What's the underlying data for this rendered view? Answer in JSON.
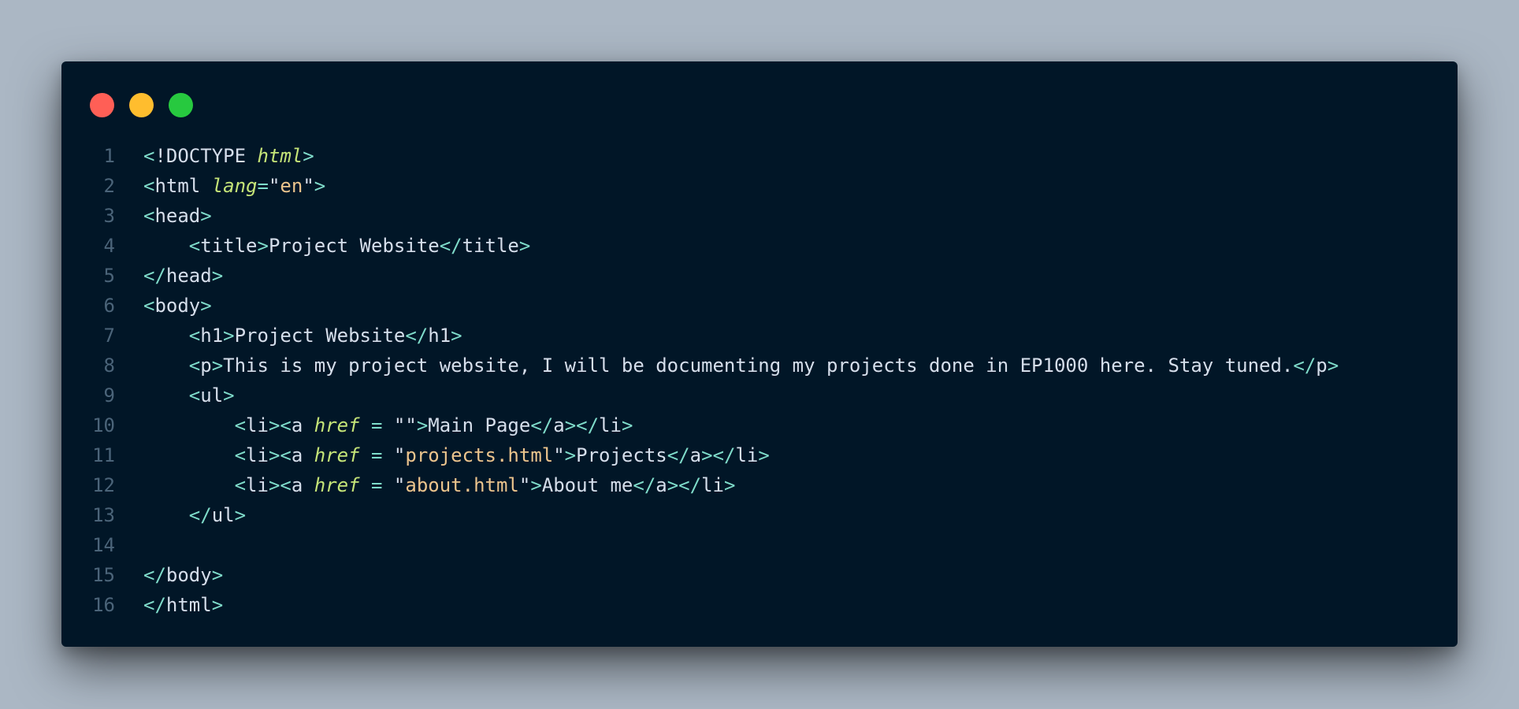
{
  "window": {
    "controls": [
      {
        "name": "close",
        "color": "#ff5f56"
      },
      {
        "name": "minimize",
        "color": "#ffbd2e"
      },
      {
        "name": "maximize",
        "color": "#27c93f"
      }
    ]
  },
  "editor": {
    "lines": [
      {
        "num": "1",
        "tokens": [
          {
            "t": "<",
            "c": "punc"
          },
          {
            "t": "!DOCTYPE ",
            "c": "kw"
          },
          {
            "t": "html",
            "c": "attr"
          },
          {
            "t": ">",
            "c": "punc"
          }
        ]
      },
      {
        "num": "2",
        "tokens": [
          {
            "t": "<",
            "c": "punc"
          },
          {
            "t": "html ",
            "c": "tag"
          },
          {
            "t": "lang",
            "c": "attr"
          },
          {
            "t": "=",
            "c": "punc"
          },
          {
            "t": "\"",
            "c": "tag"
          },
          {
            "t": "en",
            "c": "str"
          },
          {
            "t": "\"",
            "c": "tag"
          },
          {
            "t": ">",
            "c": "punc"
          }
        ]
      },
      {
        "num": "3",
        "tokens": [
          {
            "t": "<",
            "c": "punc"
          },
          {
            "t": "head",
            "c": "tag"
          },
          {
            "t": ">",
            "c": "punc"
          }
        ]
      },
      {
        "num": "4",
        "tokens": [
          {
            "t": "    ",
            "c": "tag"
          },
          {
            "t": "<",
            "c": "punc"
          },
          {
            "t": "title",
            "c": "tag"
          },
          {
            "t": ">",
            "c": "punc"
          },
          {
            "t": "Project Website",
            "c": "tag"
          },
          {
            "t": "</",
            "c": "punc"
          },
          {
            "t": "title",
            "c": "tag"
          },
          {
            "t": ">",
            "c": "punc"
          }
        ]
      },
      {
        "num": "5",
        "tokens": [
          {
            "t": "</",
            "c": "punc"
          },
          {
            "t": "head",
            "c": "tag"
          },
          {
            "t": ">",
            "c": "punc"
          }
        ]
      },
      {
        "num": "6",
        "tokens": [
          {
            "t": "<",
            "c": "punc"
          },
          {
            "t": "body",
            "c": "tag"
          },
          {
            "t": ">",
            "c": "punc"
          }
        ]
      },
      {
        "num": "7",
        "tokens": [
          {
            "t": "    ",
            "c": "tag"
          },
          {
            "t": "<",
            "c": "punc"
          },
          {
            "t": "h1",
            "c": "tag"
          },
          {
            "t": ">",
            "c": "punc"
          },
          {
            "t": "Project Website",
            "c": "tag"
          },
          {
            "t": "</",
            "c": "punc"
          },
          {
            "t": "h1",
            "c": "tag"
          },
          {
            "t": ">",
            "c": "punc"
          }
        ]
      },
      {
        "num": "8",
        "tokens": [
          {
            "t": "    ",
            "c": "tag"
          },
          {
            "t": "<",
            "c": "punc"
          },
          {
            "t": "p",
            "c": "tag"
          },
          {
            "t": ">",
            "c": "punc"
          },
          {
            "t": "This is my project website, I will be documenting my projects done in EP1000 here. Stay tuned.",
            "c": "tag"
          },
          {
            "t": "</",
            "c": "punc"
          },
          {
            "t": "p",
            "c": "tag"
          },
          {
            "t": ">",
            "c": "punc"
          }
        ]
      },
      {
        "num": "9",
        "tokens": [
          {
            "t": "    ",
            "c": "tag"
          },
          {
            "t": "<",
            "c": "punc"
          },
          {
            "t": "ul",
            "c": "tag"
          },
          {
            "t": ">",
            "c": "punc"
          }
        ]
      },
      {
        "num": "10",
        "tokens": [
          {
            "t": "        ",
            "c": "tag"
          },
          {
            "t": "<",
            "c": "punc"
          },
          {
            "t": "li",
            "c": "tag"
          },
          {
            "t": "><",
            "c": "punc"
          },
          {
            "t": "a ",
            "c": "tag"
          },
          {
            "t": "href",
            "c": "attr"
          },
          {
            "t": " = ",
            "c": "punc"
          },
          {
            "t": "\"\"",
            "c": "tag"
          },
          {
            "t": ">",
            "c": "punc"
          },
          {
            "t": "Main Page",
            "c": "tag"
          },
          {
            "t": "</",
            "c": "punc"
          },
          {
            "t": "a",
            "c": "tag"
          },
          {
            "t": "></",
            "c": "punc"
          },
          {
            "t": "li",
            "c": "tag"
          },
          {
            "t": ">",
            "c": "punc"
          }
        ]
      },
      {
        "num": "11",
        "tokens": [
          {
            "t": "        ",
            "c": "tag"
          },
          {
            "t": "<",
            "c": "punc"
          },
          {
            "t": "li",
            "c": "tag"
          },
          {
            "t": "><",
            "c": "punc"
          },
          {
            "t": "a ",
            "c": "tag"
          },
          {
            "t": "href",
            "c": "attr"
          },
          {
            "t": " = ",
            "c": "punc"
          },
          {
            "t": "\"",
            "c": "tag"
          },
          {
            "t": "projects.html",
            "c": "str"
          },
          {
            "t": "\"",
            "c": "tag"
          },
          {
            "t": ">",
            "c": "punc"
          },
          {
            "t": "Projects",
            "c": "tag"
          },
          {
            "t": "</",
            "c": "punc"
          },
          {
            "t": "a",
            "c": "tag"
          },
          {
            "t": "></",
            "c": "punc"
          },
          {
            "t": "li",
            "c": "tag"
          },
          {
            "t": ">",
            "c": "punc"
          }
        ]
      },
      {
        "num": "12",
        "tokens": [
          {
            "t": "        ",
            "c": "tag"
          },
          {
            "t": "<",
            "c": "punc"
          },
          {
            "t": "li",
            "c": "tag"
          },
          {
            "t": "><",
            "c": "punc"
          },
          {
            "t": "a ",
            "c": "tag"
          },
          {
            "t": "href",
            "c": "attr"
          },
          {
            "t": " = ",
            "c": "punc"
          },
          {
            "t": "\"",
            "c": "tag"
          },
          {
            "t": "about.html",
            "c": "str"
          },
          {
            "t": "\"",
            "c": "tag"
          },
          {
            "t": ">",
            "c": "punc"
          },
          {
            "t": "About me",
            "c": "tag"
          },
          {
            "t": "</",
            "c": "punc"
          },
          {
            "t": "a",
            "c": "tag"
          },
          {
            "t": "></",
            "c": "punc"
          },
          {
            "t": "li",
            "c": "tag"
          },
          {
            "t": ">",
            "c": "punc"
          }
        ]
      },
      {
        "num": "13",
        "tokens": [
          {
            "t": "    ",
            "c": "tag"
          },
          {
            "t": "</",
            "c": "punc"
          },
          {
            "t": "ul",
            "c": "tag"
          },
          {
            "t": ">",
            "c": "punc"
          }
        ]
      },
      {
        "num": "14",
        "tokens": []
      },
      {
        "num": "15",
        "tokens": [
          {
            "t": "</",
            "c": "punc"
          },
          {
            "t": "body",
            "c": "tag"
          },
          {
            "t": ">",
            "c": "punc"
          }
        ]
      },
      {
        "num": "16",
        "tokens": [
          {
            "t": "</",
            "c": "punc"
          },
          {
            "t": "html",
            "c": "tag"
          },
          {
            "t": ">",
            "c": "punc"
          }
        ]
      }
    ]
  }
}
